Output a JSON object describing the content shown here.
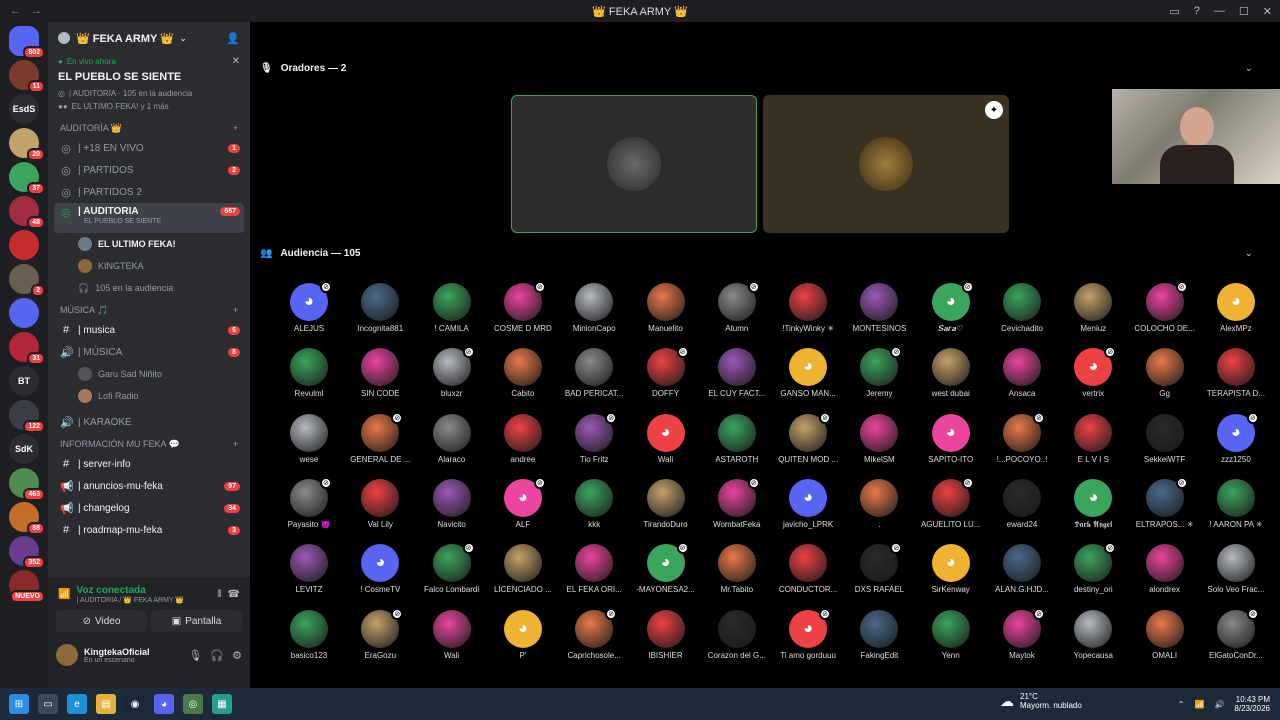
{
  "window": {
    "title": "👑 FEKA ARMY 👑"
  },
  "servers": [
    {
      "label": "",
      "badge": "802",
      "color": "#5865f2"
    },
    {
      "label": "",
      "badge": "11",
      "color": "#7a3b2e"
    },
    {
      "label": "EsdS",
      "badge": "",
      "color": "#2b2d31"
    },
    {
      "label": "",
      "badge": "20",
      "color": "#c4a16b"
    },
    {
      "label": "",
      "badge": "37",
      "color": "#3ba55d"
    },
    {
      "label": "",
      "badge": "48",
      "color": "#a12d40"
    },
    {
      "label": "",
      "badge": "",
      "color": "#c62e2e"
    },
    {
      "label": "",
      "badge": "2",
      "color": "#6b5e4e"
    },
    {
      "label": "",
      "badge": "",
      "color": "#5865f2"
    },
    {
      "label": "",
      "badge": "31",
      "color": "#b3263b"
    },
    {
      "label": "BT",
      "badge": "",
      "color": "#2b2d31"
    },
    {
      "label": "",
      "badge": "122",
      "color": "#3b3f45"
    },
    {
      "label": "SdK",
      "badge": "",
      "color": "#2b2d31"
    },
    {
      "label": "",
      "badge": "463",
      "color": "#4f8a4f"
    },
    {
      "label": "",
      "badge": "88",
      "color": "#c46d2b"
    },
    {
      "label": "",
      "badge": "352",
      "color": "#6a3b8e"
    },
    {
      "label": "",
      "badge": "NUEVO",
      "color": "#8a2a2a"
    }
  ],
  "guild": {
    "name": "👑 FEKA ARMY 👑"
  },
  "live": {
    "tag": "En vivo ahora",
    "event": "EL PUEBLO SE SIENTE",
    "info": "| AUDITORIA · 105 en la audiencia",
    "people": "EL ULTIMO FEKA! y 1 más"
  },
  "categories": {
    "auditoria": "AUDITORÍA 👑",
    "musica": "MÚSICA 🎵",
    "info": "INFORMACIÓN MU FEKA 💬"
  },
  "channels": {
    "envivo": {
      "name": "| +18 EN VIVO",
      "count": "1"
    },
    "partidos": {
      "name": "| PARTIDOS",
      "count": "2"
    },
    "partidos2": {
      "name": "| PARTIDOS 2"
    },
    "auditoria": {
      "name": "| AUDITORIA",
      "count": "667",
      "sub": "EL PUEBLO SE SIENTE"
    },
    "m1": "EL ULTIMO FEKA!",
    "m2": "KINGTEKA",
    "m3": "105 en la audiencia",
    "musica": {
      "name": "| musica",
      "count": "6"
    },
    "musica2": {
      "name": "| MÚSICA",
      "count": "8"
    },
    "m4": "Garu Sad Niñito",
    "m5": "Lofi Radio",
    "karaoke": {
      "name": "| KARAOKE"
    },
    "serverinfo": {
      "name": "| server-info"
    },
    "anuncios": {
      "name": "| anuncios-mu-feka",
      "count": "97"
    },
    "changelog": {
      "name": "| changelog",
      "count": "34"
    },
    "roadmap": {
      "name": "| roadmap-mu-feka",
      "count": "3"
    }
  },
  "voice": {
    "status": "Voz conectada",
    "where": "| AUDITORIA / 👑 FEKA ARMY 👑",
    "video": "Video",
    "screen": "Pantalla"
  },
  "user": {
    "name": "KingtekaOficial",
    "status": "En un escenario"
  },
  "stage": {
    "speakers_label": "Oradores — 2",
    "audience_label": "Audiencia — 105"
  },
  "audience": [
    [
      "ALEJUS",
      "Incognita881",
      "! CAMILA",
      "COSME D MRD",
      "MinionCapo",
      "Manuelito",
      "Atumn",
      "!TinkyWinky ✳",
      "MONTESINOS",
      "𝑺𝒂𝒓𝒂♡",
      "Cevichadito",
      "Meniuz",
      "COLOCHO DE...",
      "AlexMPz"
    ],
    [
      "Revulml",
      "SIN CODE",
      "bluxzr",
      "Cabito",
      "BAD PERICAT...",
      "DOFFY",
      "EL CUY FACT...",
      "GANSO MAN...",
      "Jeremy",
      "west dubai",
      "Ansaca",
      "vertrix",
      "Gg",
      "TERAPISTA D..."
    ],
    [
      "wese",
      "GENERAL DE ...",
      "Alaraco",
      "andree",
      "Tio Fritz",
      "Wali",
      "ASTAROTH",
      "QUITEN MOD ...",
      "MikelSM",
      "SAPITO-ITO",
      "!...POCOYO..!",
      "E L V I S",
      "SekkeiWTF",
      "zzz1250"
    ],
    [
      "Payasito 👿",
      "Val Lily",
      "Navicito",
      "ALF",
      "kkk",
      "TirandoDuro",
      "WombatFeka",
      "javicho_LPRK",
      ".",
      "AGUELITO LU...",
      "eward24",
      "𝕯𝖆𝖗𝖐 𝕬𝖓𝖌𝖊𝖑",
      "ELTRAPOS... ✳",
      "! AARON PA ✳"
    ],
    [
      "LEVITZ",
      "! CosmeTV",
      "Falco Lombardi",
      "LICENCIADO ...",
      "EL FEKA ORI...",
      "-MAYONESA2...",
      "Mr.Tabito",
      "CONDUCTOR...",
      "DXS RAFAEL",
      "SirKenway",
      "ALAN.G.HJD...",
      "destiny_ori",
      "alondrex",
      "Solo Veo Frac..."
    ],
    [
      "basico123",
      "EraGozu",
      "Wali",
      "P'",
      "Caprichosole...",
      "IBISHIER",
      "Corazon del G...",
      "Ti amo gorduuu",
      "FakingEdit",
      "Yenn",
      "Maytok",
      "Yopecausa",
      "OMALI",
      "ElGatoConDr..."
    ]
  ],
  "weather": {
    "temp": "21°C",
    "desc": "Mayorm. nublado"
  },
  "clock": {
    "time": "10:43 PM",
    "date": "8/23/2026"
  }
}
